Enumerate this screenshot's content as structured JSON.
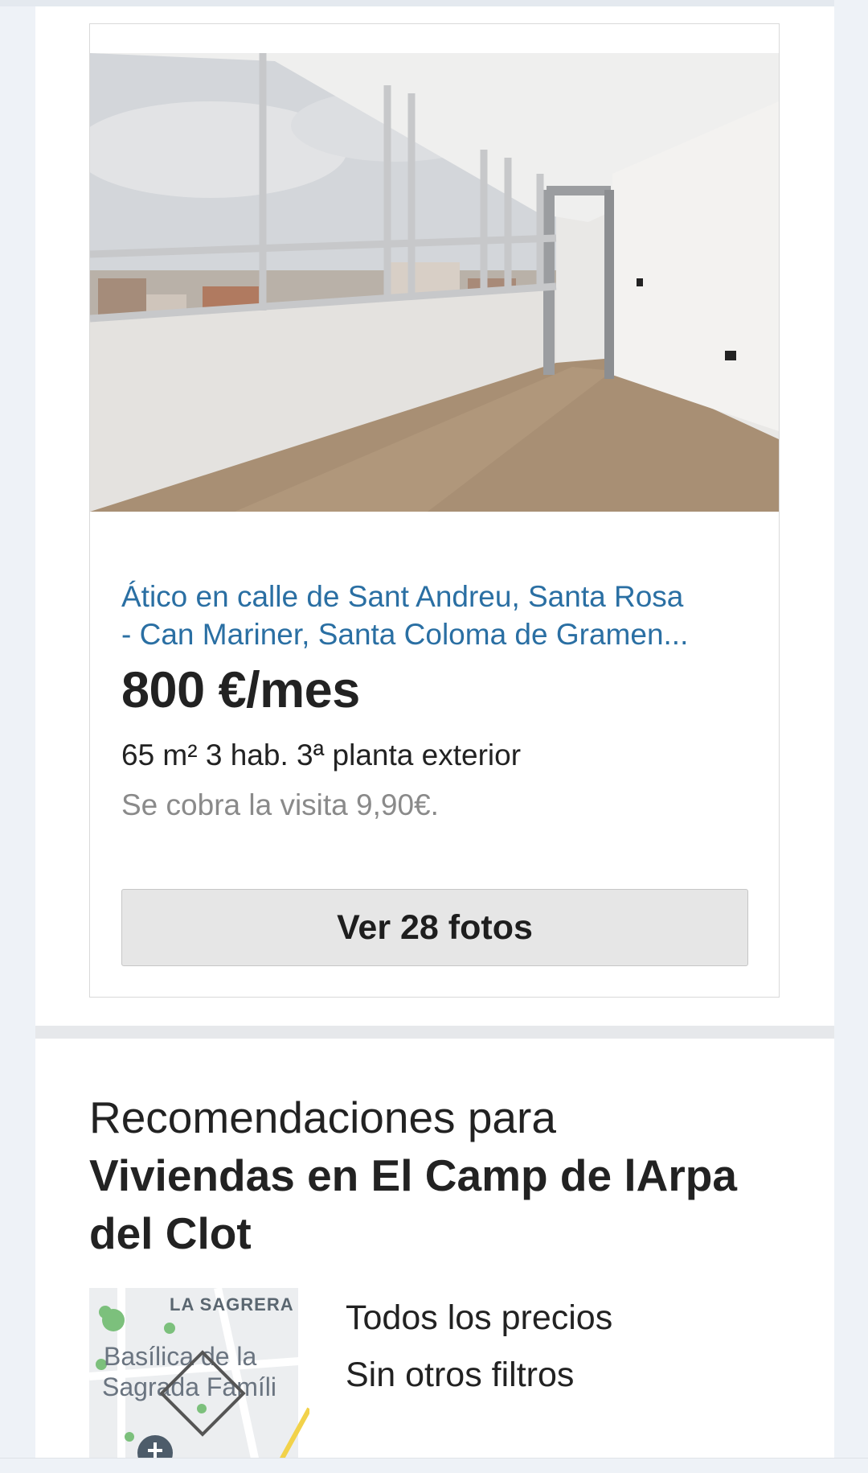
{
  "listing": {
    "photo_alt": "Ático interior con ventanales",
    "title_line1": "Ático en calle de Sant Andreu, Santa Rosa",
    "title_line2": "- Can Mariner, Santa Coloma de Gramen...",
    "price": "800 €/mes",
    "details": "65 m² 3 hab. 3ª planta exterior",
    "note": "Se cobra la visita 9,90€.",
    "photos_button": "Ver 28 fotos"
  },
  "recommendations": {
    "heading_light": "Recomendaciones para",
    "heading_bold_1": "Viviendas en El Camp de lArpa",
    "heading_bold_2": "del Clot",
    "map_labels": {
      "district": "LA SAGRERA",
      "poi_line1": "Basílica de la",
      "poi_line2": "Sagrada Famíli"
    },
    "filters": [
      "Todos los precios",
      "Sin otros filtros"
    ]
  },
  "colors": {
    "link_blue": "#2a6fa3",
    "text_dark": "#222222",
    "text_muted": "#8a8a8a",
    "button_bg": "#e6e6e6",
    "page_bg": "#eef2f7"
  }
}
